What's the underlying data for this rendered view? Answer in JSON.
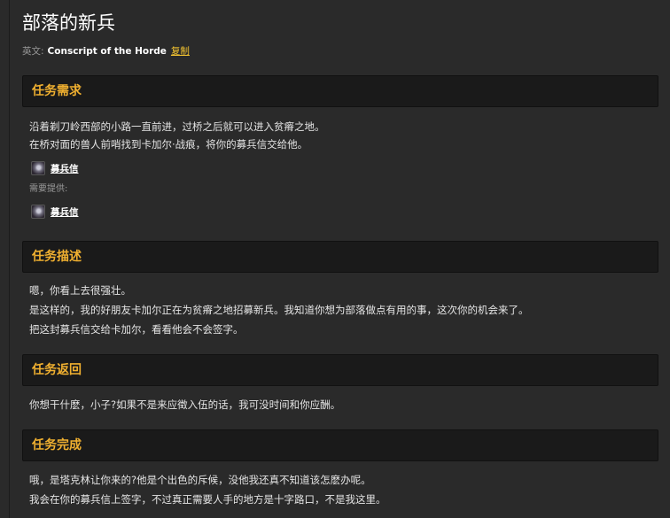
{
  "quest": {
    "title": "部落的新兵",
    "english_prefix": "英文:",
    "english_name": "Conscript of the Horde",
    "copy_label": "复制"
  },
  "sections": {
    "requirements": {
      "header": "任务需求",
      "lines": [
        "沿着剃刀岭西部的小路一直前进，过桥之后就可以进入贫瘠之地。",
        "在桥对面的兽人前哨找到卡加尔·战痕，将你的募兵信交给他。"
      ],
      "item_name": "募兵信",
      "provided_label": "需要提供:",
      "provided_item_name": "募兵信"
    },
    "description": {
      "header": "任务描述",
      "lines": [
        "嗯，你看上去很强壮。",
        "是这样的，我的好朋友卡加尔正在为贫瘠之地招募新兵。我知道你想为部落做点有用的事，这次你的机会来了。",
        "把这封募兵信交给卡加尔，看看他会不会签字。"
      ]
    },
    "progress": {
      "header": "任务返回",
      "lines": [
        "你想干什麽，小子?如果不是来应徵入伍的话，我可没时间和你应酬。"
      ]
    },
    "completion": {
      "header": "任务完成",
      "lines": [
        "哦，是塔克林让你来的?他是个出色的斥候，没他我还真不知道该怎麽办呢。",
        "我会在你的募兵信上签字，不过真正需要人手的地方是十字路口，不是我这里。"
      ]
    }
  },
  "colors": {
    "header_text": "#f0b030",
    "link": "#f4c430",
    "background": "#2a2a2a",
    "header_bg": "#1a1a1a"
  },
  "icons": {
    "item": "scroll-letter-icon"
  }
}
